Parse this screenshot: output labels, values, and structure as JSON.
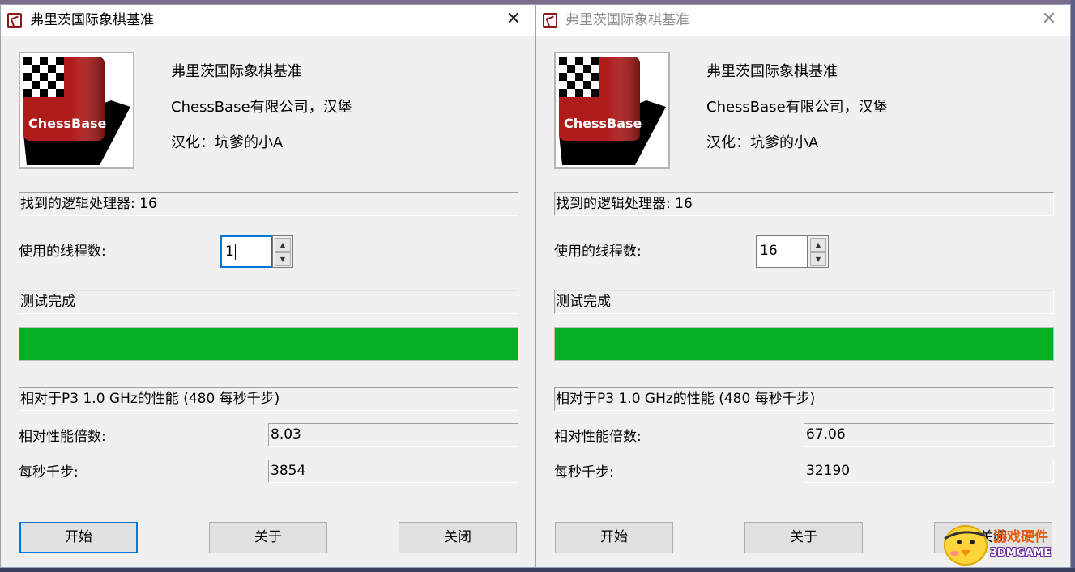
{
  "windows": [
    {
      "title": "弗里茨国际象棋基准",
      "logo_text": "ChessBase",
      "info": [
        "弗里茨国际象棋基准",
        "ChessBase有限公司，汉堡",
        "汉化：坑爹的小A"
      ],
      "processors_label": "找到的逻辑处理器: 16",
      "threads_label": "使用的线程数:",
      "threads_value": "1",
      "status": "测试完成",
      "progress_fraction": 1.0,
      "relative_label": "相对于P3 1.0 GHz的性能 (480 每秒千步)",
      "factor_label": "相对性能倍数:",
      "factor_value": "8.03",
      "kns_label": "每秒千步:",
      "kns_value": "3854",
      "buttons": {
        "start": "开始",
        "about": "关于",
        "close": "关闭"
      }
    },
    {
      "title": "弗里茨国际象棋基准",
      "logo_text": "ChessBase",
      "info": [
        "弗里茨国际象棋基准",
        "ChessBase有限公司，汉堡",
        "汉化：坑爹的小A"
      ],
      "processors_label": "找到的逻辑处理器: 16",
      "threads_label": "使用的线程数:",
      "threads_value": "16",
      "status": "测试完成",
      "progress_fraction": 1.0,
      "relative_label": "相对于P3 1.0 GHz的性能 (480 每秒千步)",
      "factor_label": "相对性能倍数:",
      "factor_value": "67.06",
      "kns_label": "每秒千步:",
      "kns_value": "32190",
      "buttons": {
        "start": "开始",
        "about": "关于",
        "close": "关闭"
      }
    }
  ],
  "watermark": {
    "line1": "游戏硬件",
    "line2": "3DMGAME"
  },
  "colors": {
    "progress": "#06b025",
    "focus": "#0078d7",
    "logo_red": "#b01c1c",
    "window_bg": "#f0f0f0"
  },
  "icons": {
    "app": "chessbase-app-icon",
    "close": "close-icon",
    "spin_up": "caret-up-icon",
    "spin_down": "caret-down-icon"
  }
}
